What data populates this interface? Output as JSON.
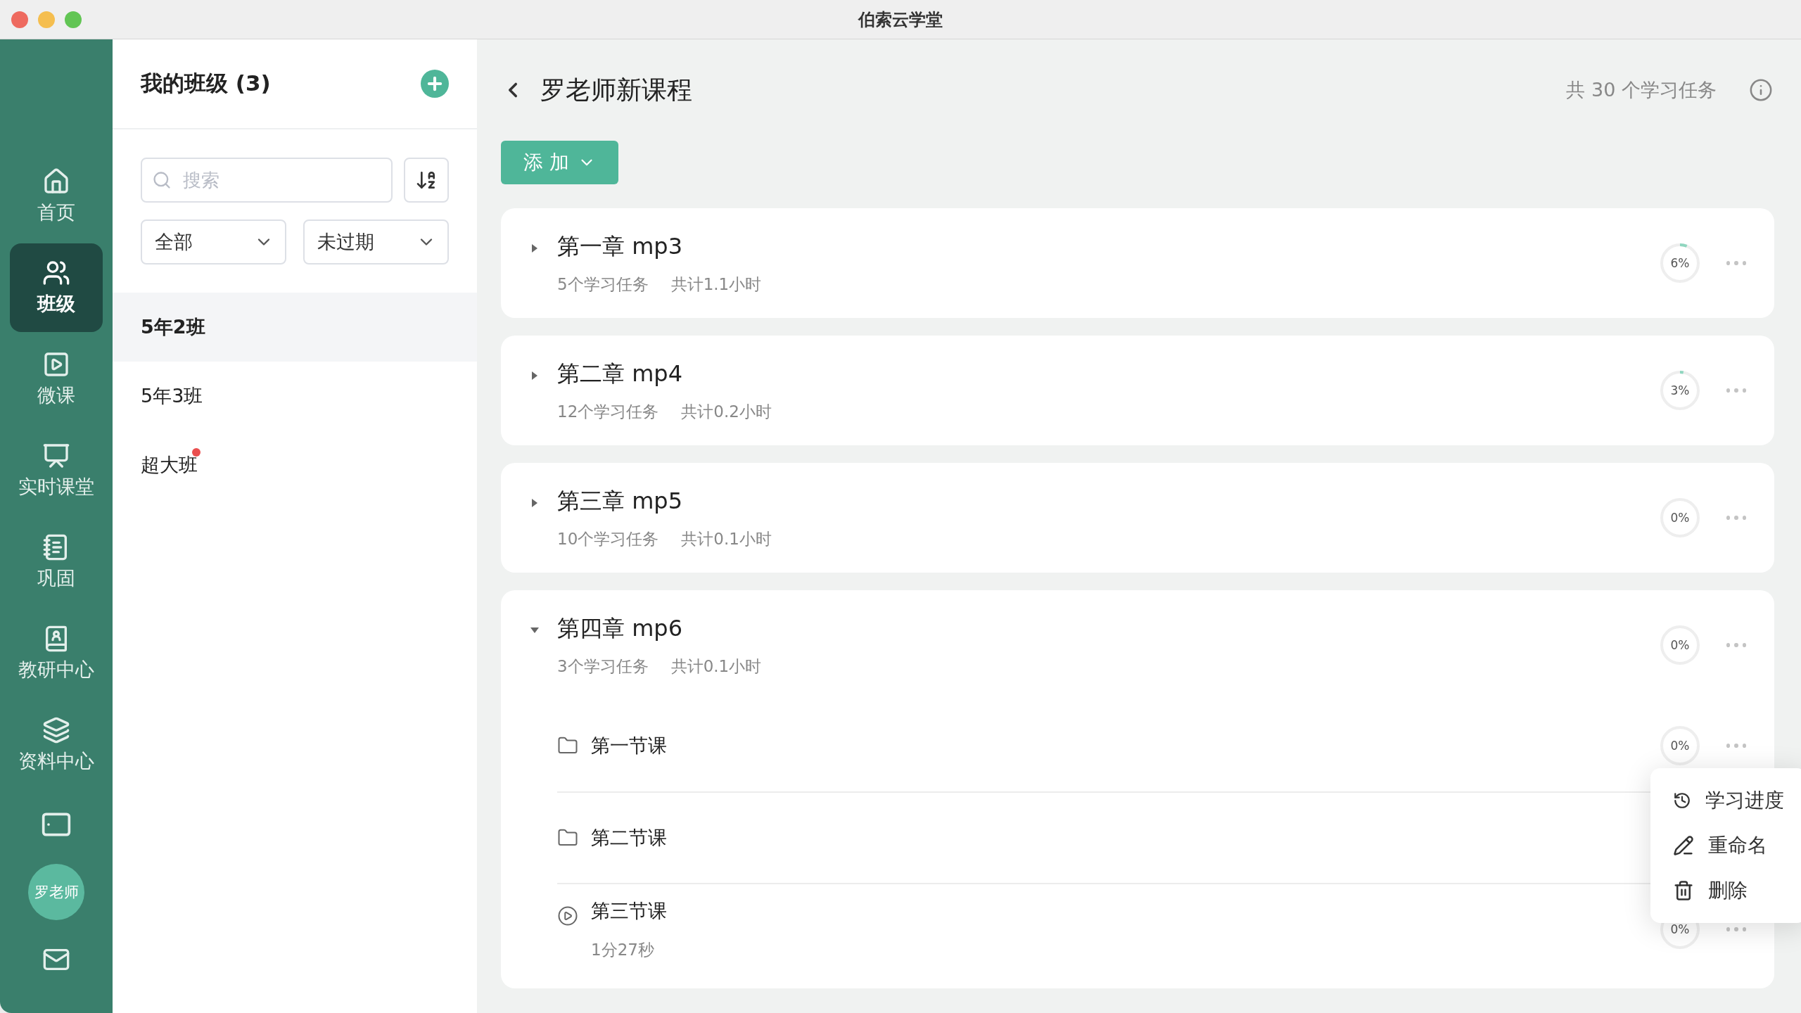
{
  "window": {
    "title": "伯索云学堂"
  },
  "nav": {
    "items": [
      {
        "label": "首页",
        "selected": false
      },
      {
        "label": "班级",
        "selected": true
      },
      {
        "label": "微课",
        "selected": false
      },
      {
        "label": "实时课堂",
        "selected": false
      },
      {
        "label": "巩固",
        "selected": false
      },
      {
        "label": "教研中心",
        "selected": false
      },
      {
        "label": "资料中心",
        "selected": false
      }
    ],
    "avatar": "罗老师"
  },
  "classes": {
    "title": "我的班级 (3)",
    "search": {
      "placeholder": "搜索"
    },
    "filters": [
      "全部",
      "未过期"
    ],
    "items": [
      {
        "name": "5年2班",
        "selected": true,
        "unread": false
      },
      {
        "name": "5年3班",
        "selected": false,
        "unread": false
      },
      {
        "name": "超大班",
        "selected": false,
        "unread": true
      }
    ]
  },
  "course": {
    "title": "罗老师新课程",
    "summary": "共 30 个学习任务",
    "add_button": "添 加",
    "chapters": [
      {
        "title": "第一章 mp3",
        "tasks": "5个学习任务",
        "duration": "共计1.1小时",
        "progress": "6%",
        "level": 0.06,
        "expanded": false
      },
      {
        "title": "第二章 mp4",
        "tasks": "12个学习任务",
        "duration": "共计0.2小时",
        "progress": "3%",
        "level": 0.03,
        "expanded": false
      },
      {
        "title": "第三章 mp5",
        "tasks": "10个学习任务",
        "duration": "共计0.1小时",
        "progress": "0%",
        "level": 0,
        "expanded": false
      },
      {
        "title": "第四章 mp6",
        "tasks": "3个学习任务",
        "duration": "共计0.1小时",
        "progress": "0%",
        "level": 0,
        "expanded": true,
        "children": [
          {
            "kind": "folder",
            "title": "第一节课",
            "progress": "0%",
            "level": 0
          },
          {
            "kind": "folder",
            "title": "第二节课"
          },
          {
            "kind": "video",
            "title": "第三节课",
            "subtitle": "1分27秒",
            "progress": "0%",
            "level": 0
          }
        ]
      }
    ]
  },
  "context_menu": [
    {
      "kind": "progress",
      "label": "学习进度"
    },
    {
      "kind": "rename",
      "label": "重命名"
    },
    {
      "kind": "delete",
      "label": "删除"
    }
  ]
}
